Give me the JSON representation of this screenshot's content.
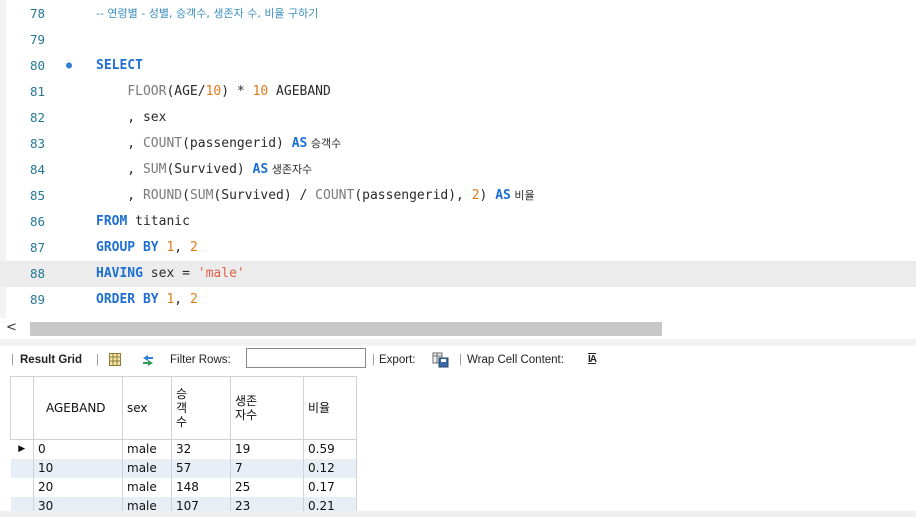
{
  "editor": {
    "lines": [
      {
        "num": "78",
        "tokens": [
          {
            "t": "-- 연령별 - 성별, 승객수, 생존자 수, 비율 구하기",
            "c": "cm ko"
          }
        ]
      },
      {
        "num": "79",
        "tokens": []
      },
      {
        "num": "80",
        "dot": "●",
        "tokens": [
          {
            "t": "SELECT",
            "c": "kw"
          }
        ]
      },
      {
        "num": "81",
        "tokens": [
          {
            "t": "    ",
            "c": ""
          },
          {
            "t": "FLOOR",
            "c": "fn"
          },
          {
            "t": "(AGE/",
            "c": "id"
          },
          {
            "t": "10",
            "c": "num"
          },
          {
            "t": ") * ",
            "c": "id"
          },
          {
            "t": "10",
            "c": "num"
          },
          {
            "t": " AGEBAND",
            "c": "id"
          }
        ]
      },
      {
        "num": "82",
        "tokens": [
          {
            "t": "    , sex",
            "c": "id"
          }
        ]
      },
      {
        "num": "83",
        "tokens": [
          {
            "t": "    , ",
            "c": "id"
          },
          {
            "t": "COUNT",
            "c": "fn"
          },
          {
            "t": "(passengerid) ",
            "c": "id"
          },
          {
            "t": "AS",
            "c": "kw"
          },
          {
            "t": " 승객수",
            "c": "id ko"
          }
        ]
      },
      {
        "num": "84",
        "tokens": [
          {
            "t": "    , ",
            "c": "id"
          },
          {
            "t": "SUM",
            "c": "fn"
          },
          {
            "t": "(Survived) ",
            "c": "id"
          },
          {
            "t": "AS",
            "c": "kw"
          },
          {
            "t": " 생존자수",
            "c": "id ko"
          }
        ]
      },
      {
        "num": "85",
        "tokens": [
          {
            "t": "    , ",
            "c": "id"
          },
          {
            "t": "ROUND",
            "c": "fn"
          },
          {
            "t": "(",
            "c": "id"
          },
          {
            "t": "SUM",
            "c": "fn"
          },
          {
            "t": "(Survived) / ",
            "c": "id"
          },
          {
            "t": "COUNT",
            "c": "fn"
          },
          {
            "t": "(passengerid), ",
            "c": "id"
          },
          {
            "t": "2",
            "c": "num"
          },
          {
            "t": ") ",
            "c": "id"
          },
          {
            "t": "AS",
            "c": "kw"
          },
          {
            "t": " 비율",
            "c": "id ko"
          }
        ]
      },
      {
        "num": "86",
        "tokens": [
          {
            "t": "FROM",
            "c": "kw"
          },
          {
            "t": " titanic",
            "c": "id"
          }
        ]
      },
      {
        "num": "87",
        "tokens": [
          {
            "t": "GROUP BY",
            "c": "kw"
          },
          {
            "t": " ",
            "c": "id"
          },
          {
            "t": "1",
            "c": "num"
          },
          {
            "t": ", ",
            "c": "id"
          },
          {
            "t": "2",
            "c": "num"
          }
        ]
      },
      {
        "num": "88",
        "highlight": true,
        "tokens": [
          {
            "t": "HAVING",
            "c": "kw"
          },
          {
            "t": " sex = ",
            "c": "id"
          },
          {
            "t": "'male'",
            "c": "str"
          }
        ]
      },
      {
        "num": "89",
        "tokens": [
          {
            "t": "ORDER BY",
            "c": "kw"
          },
          {
            "t": " ",
            "c": "id"
          },
          {
            "t": "1",
            "c": "num"
          },
          {
            "t": ", ",
            "c": "id"
          },
          {
            "t": "2",
            "c": "num"
          }
        ]
      }
    ]
  },
  "scroll": {
    "left_arrow": "<"
  },
  "toolbar": {
    "result_grid": "Result Grid",
    "sep": "|",
    "filter_rows": "Filter Rows:",
    "filter_value": "",
    "export": "Export:",
    "wrap_cell": "Wrap Cell Content:",
    "wrap_icon": "IA"
  },
  "grid": {
    "columns": [
      "AGEBAND",
      "sex",
      "승객수",
      "생존자수",
      "비율"
    ],
    "rows": [
      {
        "marker": "▶",
        "cells": [
          "0",
          "male",
          "32",
          "19",
          "0.59"
        ]
      },
      {
        "marker": "",
        "cells": [
          "10",
          "male",
          "57",
          "7",
          "0.12"
        ]
      },
      {
        "marker": "",
        "cells": [
          "20",
          "male",
          "148",
          "25",
          "0.17"
        ]
      },
      {
        "marker": "",
        "cells": [
          "30",
          "male",
          "107",
          "23",
          "0.21"
        ]
      }
    ]
  }
}
